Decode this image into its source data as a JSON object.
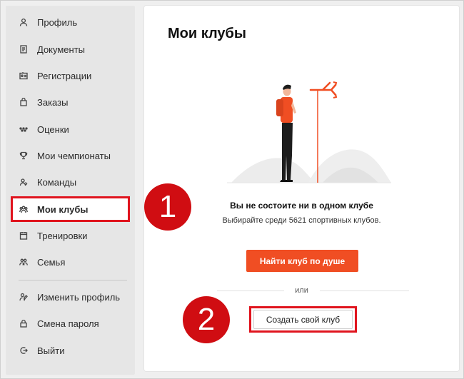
{
  "sidebar": {
    "items": [
      {
        "label": "Профиль",
        "icon": "user-icon"
      },
      {
        "label": "Документы",
        "icon": "document-icon"
      },
      {
        "label": "Регистрации",
        "icon": "id-card-icon"
      },
      {
        "label": "Заказы",
        "icon": "shopping-bag-icon"
      },
      {
        "label": "Оценки",
        "icon": "rating-dots-icon"
      },
      {
        "label": "Мои чемпионаты",
        "icon": "trophy-icon"
      },
      {
        "label": "Команды",
        "icon": "team-icon"
      },
      {
        "label": "Мои клубы",
        "icon": "clubs-icon",
        "active": true
      },
      {
        "label": "Тренировки",
        "icon": "calendar-icon"
      },
      {
        "label": "Семья",
        "icon": "family-icon"
      }
    ],
    "bottom_items": [
      {
        "label": "Изменить профиль",
        "icon": "edit-profile-icon"
      },
      {
        "label": "Смена пароля",
        "icon": "lock-icon"
      },
      {
        "label": "Выйти",
        "icon": "logout-icon"
      }
    ]
  },
  "main": {
    "title": "Мои клубы",
    "empty_state": {
      "title": "Вы не состоите ни в одном клубе",
      "subtitle": "Выбирайте среди 5621 спортивных клубов.",
      "find_button": "Найти клуб по душе",
      "or_text": "или",
      "create_button": "Создать свой клуб"
    }
  },
  "callouts": {
    "first": "1",
    "second": "2"
  },
  "colors": {
    "accent": "#f04e23",
    "highlight": "#e0141e",
    "callout": "#d00d12"
  }
}
